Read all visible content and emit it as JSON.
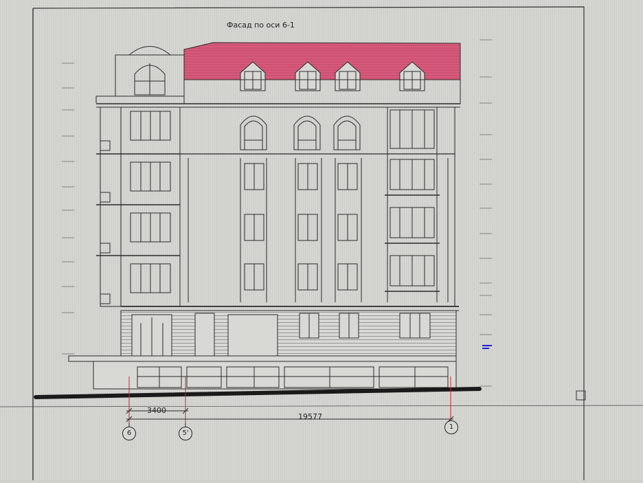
{
  "drawing": {
    "title": "Фасад по оси 6-1",
    "dimensions": [
      {
        "value": "3400"
      },
      {
        "value": "19577"
      }
    ],
    "axes": [
      {
        "label": "6"
      },
      {
        "label": "5'"
      },
      {
        "label": "1"
      }
    ]
  },
  "colors": {
    "roof": "#d85a7c",
    "lines": "#2a2a2a",
    "paper": "#d8d9d5",
    "ground": "#1a1a1a",
    "dim_line": "#d2233c",
    "highlight_mark": "#2020d0"
  }
}
